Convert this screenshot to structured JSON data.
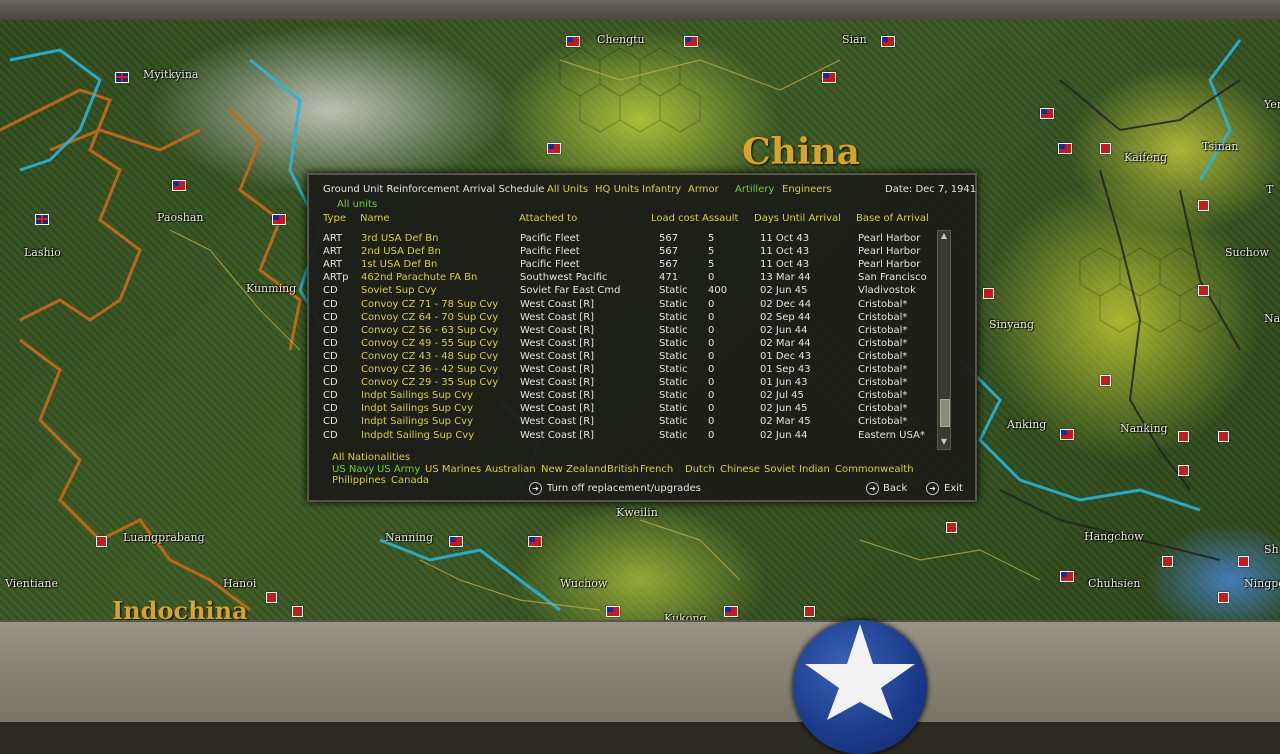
{
  "map": {
    "regions": [
      {
        "key": "china",
        "text": "China"
      },
      {
        "key": "indochina",
        "text": "Indochina"
      }
    ],
    "places": [
      "Myitkyina",
      "Chengtu",
      "Sian",
      "Paoshan",
      "Lashio",
      "Kunming",
      "Kaifeng",
      "Tsinan",
      "Suchow",
      "Sinyang",
      "Anking",
      "Nanking",
      "Hangchow",
      "Chuhsien",
      "Ningpo",
      "Sh",
      "Kweilin",
      "Nanning",
      "Wuchow",
      "Kukong",
      "Luangprabang",
      "Hanoi",
      "Vientiane",
      "Yen",
      "Nanki",
      "T"
    ]
  },
  "dialog": {
    "title": "Ground Unit Reinforcement Arrival Schedule",
    "filters": [
      {
        "label": "All Units",
        "active": false
      },
      {
        "label": "HQ Units",
        "active": false
      },
      {
        "label": "Infantry",
        "active": false
      },
      {
        "label": "Armor",
        "active": false
      },
      {
        "label": "Artillery",
        "active": true
      },
      {
        "label": "Engineers",
        "active": false
      }
    ],
    "date": "Date: Dec 7, 1941",
    "subfilter": "All units",
    "columns": {
      "type": "Type",
      "name": "Name",
      "attached": "Attached to",
      "load": "Load cost",
      "assault": "Assault",
      "days": "Days Until Arrival",
      "base": "Base of Arrival"
    },
    "rows": [
      {
        "type": "ART",
        "name": "3rd USA Def Bn",
        "attached": "Pacific Fleet",
        "load": "567",
        "assault": "5",
        "days": "11 Oct 43",
        "base": "Pearl Harbor"
      },
      {
        "type": "ART",
        "name": "2nd USA Def Bn",
        "attached": "Pacific Fleet",
        "load": "567",
        "assault": "5",
        "days": "11 Oct 43",
        "base": "Pearl Harbor"
      },
      {
        "type": "ART",
        "name": "1st USA Def Bn",
        "attached": "Pacific Fleet",
        "load": "567",
        "assault": "5",
        "days": "11 Oct 43",
        "base": "Pearl Harbor"
      },
      {
        "type": "ARTp",
        "name": "462nd Parachute FA Bn",
        "attached": "Southwest Pacific",
        "load": "471",
        "assault": "0",
        "days": "13 Mar 44",
        "base": "San Francisco"
      },
      {
        "type": "CD",
        "name": "Soviet Sup Cvy",
        "attached": "Soviet Far East Cmd",
        "load": "Static",
        "assault": "400",
        "days": "02 Jun 45",
        "base": "Vladivostok"
      },
      {
        "type": "CD",
        "name": "Convoy CZ 71 - 78 Sup Cvy",
        "attached": "West Coast [R]",
        "load": "Static",
        "assault": "0",
        "days": "02 Dec 44",
        "base": "Cristobal*"
      },
      {
        "type": "CD",
        "name": "Convoy CZ 64 - 70 Sup Cvy",
        "attached": "West Coast [R]",
        "load": "Static",
        "assault": "0",
        "days": "02 Sep 44",
        "base": "Cristobal*"
      },
      {
        "type": "CD",
        "name": "Convoy CZ 56 - 63 Sup Cvy",
        "attached": "West Coast [R]",
        "load": "Static",
        "assault": "0",
        "days": "02 Jun 44",
        "base": "Cristobal*"
      },
      {
        "type": "CD",
        "name": "Convoy CZ 49 - 55 Sup Cvy",
        "attached": "West Coast [R]",
        "load": "Static",
        "assault": "0",
        "days": "02 Mar 44",
        "base": "Cristobal*"
      },
      {
        "type": "CD",
        "name": "Convoy CZ 43 - 48 Sup Cvy",
        "attached": "West Coast [R]",
        "load": "Static",
        "assault": "0",
        "days": "01 Dec 43",
        "base": "Cristobal*"
      },
      {
        "type": "CD",
        "name": "Convoy CZ 36 - 42 Sup Cvy",
        "attached": "West Coast [R]",
        "load": "Static",
        "assault": "0",
        "days": "01 Sep 43",
        "base": "Cristobal*"
      },
      {
        "type": "CD",
        "name": "Convoy CZ 29 - 35 Sup Cvy",
        "attached": "West Coast [R]",
        "load": "Static",
        "assault": "0",
        "days": "01 Jun 43",
        "base": "Cristobal*"
      },
      {
        "type": "CD",
        "name": "Indpt Sailings Sup Cvy",
        "attached": "West Coast [R]",
        "load": "Static",
        "assault": "0",
        "days": "02 Jul 45",
        "base": "Cristobal*"
      },
      {
        "type": "CD",
        "name": "Indpt Sailings Sup Cvy",
        "attached": "West Coast [R]",
        "load": "Static",
        "assault": "0",
        "days": "02 Jun 45",
        "base": "Cristobal*"
      },
      {
        "type": "CD",
        "name": "Indpt Sailings Sup Cvy",
        "attached": "West Coast [R]",
        "load": "Static",
        "assault": "0",
        "days": "02 Mar 45",
        "base": "Cristobal*"
      },
      {
        "type": "CD",
        "name": "Indpdt Sailing Sup Cvy",
        "attached": "West Coast [R]",
        "load": "Static",
        "assault": "0",
        "days": "02 Jun 44",
        "base": "Eastern USA*"
      }
    ],
    "all_nationalities": "All Nationalities",
    "nationalities_line1": [
      {
        "label": "US Navy",
        "active": true
      },
      {
        "label": "US Army",
        "active": true
      },
      {
        "label": "US Marines",
        "active": false
      },
      {
        "label": "Australian",
        "active": false
      },
      {
        "label": "New Zealand",
        "active": false
      },
      {
        "label": "British",
        "active": false
      },
      {
        "label": "French",
        "active": false
      },
      {
        "label": "Dutch",
        "active": false
      },
      {
        "label": "Chinese",
        "active": false
      },
      {
        "label": "Soviet",
        "active": false
      },
      {
        "label": "Indian",
        "active": false
      },
      {
        "label": "Commonwealth",
        "active": false
      }
    ],
    "nationalities_line2": [
      {
        "label": "Philippines",
        "active": false
      },
      {
        "label": "Canada",
        "active": false
      }
    ],
    "turn_off_label": "Turn off replacement/upgrades",
    "back_label": "Back",
    "exit_label": "Exit"
  },
  "colors": {
    "highlight": "#6ed228",
    "link": "#d8cc40",
    "text": "#e6e4d8"
  }
}
